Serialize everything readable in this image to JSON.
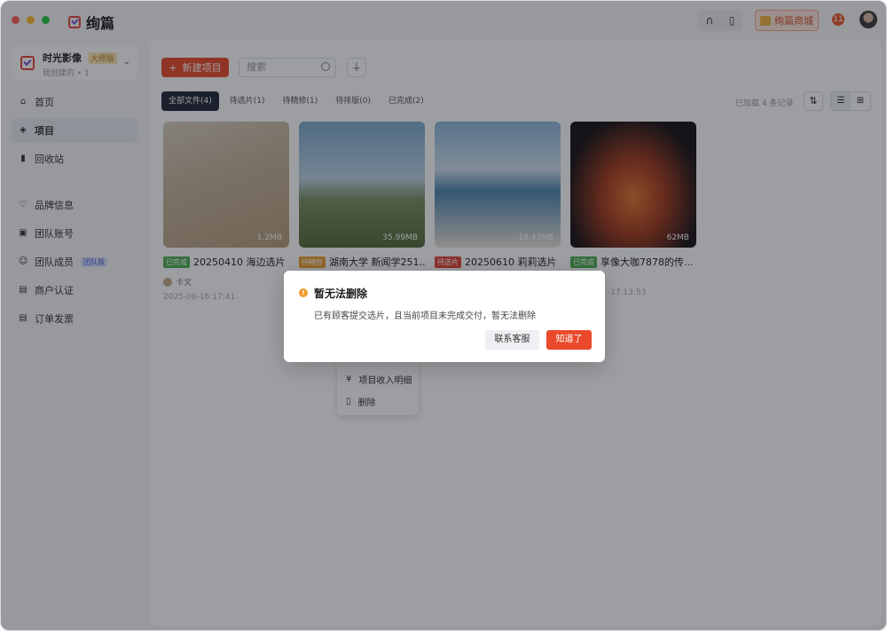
{
  "app": {
    "name": "绚篇",
    "colors": {
      "accent": "#ea4a2b",
      "bg": "#f6f7f9"
    }
  },
  "titlebar": {
    "shop_label": "绚篇商城",
    "notification_count": "11"
  },
  "workspace": {
    "name": "时光影像",
    "badge": "大师版",
    "sub": "我创建的 • 1"
  },
  "sidebar": {
    "items": [
      {
        "label": "首页",
        "icon": "home-icon"
      },
      {
        "label": "项目",
        "icon": "layers-icon"
      },
      {
        "label": "回收站",
        "icon": "trash-icon"
      },
      {
        "label": "品牌信息",
        "icon": "brand-icon"
      },
      {
        "label": "团队账号",
        "icon": "id-card-icon"
      },
      {
        "label": "团队成员",
        "icon": "team-icon",
        "tag": "团队版"
      },
      {
        "label": "商户认证",
        "icon": "document-icon"
      },
      {
        "label": "订单发票",
        "icon": "invoice-icon"
      }
    ]
  },
  "toolbar": {
    "new_project_label": "新建项目",
    "search_placeholder": "搜索"
  },
  "tabs": [
    {
      "label": "全部文件(4)"
    },
    {
      "label": "待选片(1)"
    },
    {
      "label": "待精修(1)"
    },
    {
      "label": "待排版(0)"
    },
    {
      "label": "已完成(2)"
    }
  ],
  "loaded_text": "已加载 4 条记录",
  "projects": [
    {
      "status": "已完成",
      "title": "20250410 海边选片",
      "size": "1.2MB",
      "author": "卡文",
      "date": "2025-06-16 17:41"
    },
    {
      "status": "待精修",
      "title": "湖南大学 新闻学251...",
      "size": "35.99MB",
      "author": "",
      "date": ""
    },
    {
      "status": "待选片",
      "title": "20250610 莉莉选片",
      "size": "19.43MB",
      "author": "",
      "date": ""
    },
    {
      "status": "已完成",
      "title": "享像大咖7878的传...",
      "size": "62MB",
      "author": "",
      "date": "-17 13:53"
    }
  ],
  "context_menu": {
    "income_label": "项目收入明细",
    "delete_label": "删除"
  },
  "dialog": {
    "title": "暂无法删除",
    "message": "已有顾客提交选片，且当前项目未完成交付，暂无法删除",
    "contact_label": "联系客服",
    "ok_label": "知道了"
  }
}
